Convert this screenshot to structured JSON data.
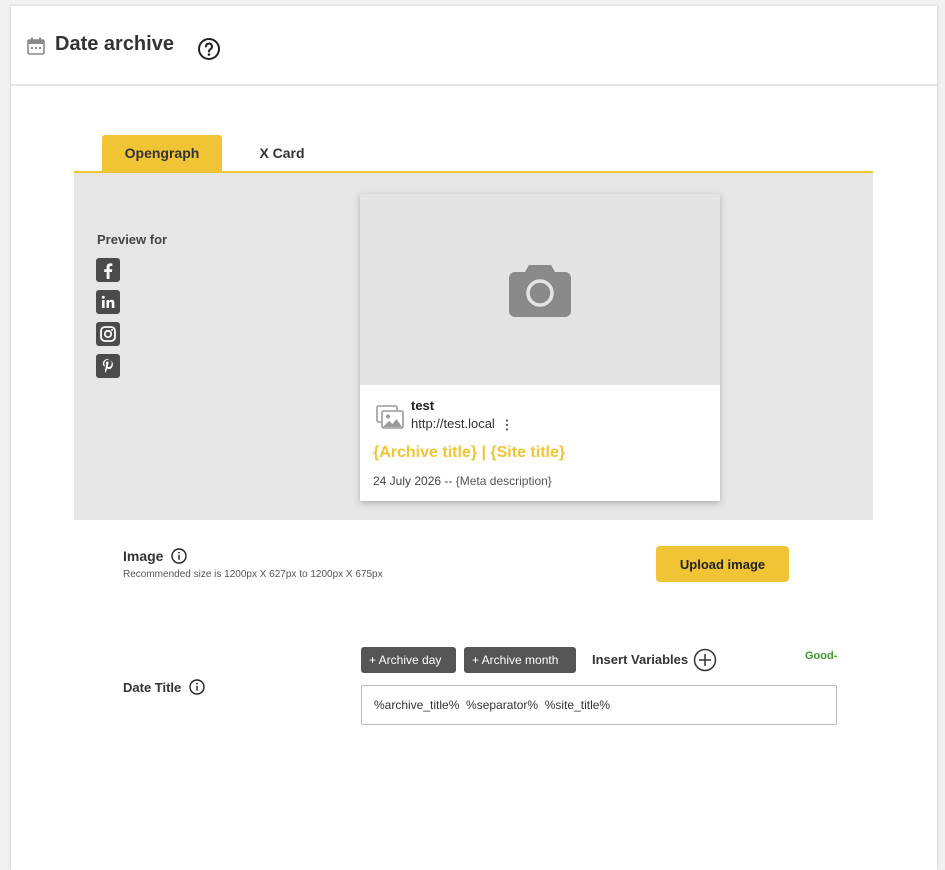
{
  "header": {
    "title": "Date archive",
    "icon": "calendar-icon",
    "help_icon": "help-icon"
  },
  "tabs": [
    {
      "label": "Opengraph",
      "active": true
    },
    {
      "label": "X Card",
      "active": false
    }
  ],
  "preview": {
    "preview_for_label": "Preview for",
    "platforms": [
      "facebook-icon",
      "linkedin-icon",
      "instagram-icon",
      "pinterest-icon"
    ],
    "card": {
      "site_name": "test",
      "site_url": "http://test.local",
      "title": "{Archive title} | {Site title}",
      "date": "24 July 2026",
      "separator": "--",
      "description": "{Meta description}"
    }
  },
  "image_section": {
    "label": "Image",
    "hint": "Recommended size is 1200px X 627px to 1200px X 675px",
    "upload_label": "Upload image"
  },
  "date_title": {
    "label": "Date Title",
    "variables": [
      "+ Archive day",
      "+ Archive month"
    ],
    "insert_label": "Insert Variables",
    "status": "Good-",
    "value": "%archive_title%  %separator%  %site_title%"
  },
  "colors": {
    "accent": "#f0c435",
    "preview_bg": "#e6e6e6",
    "status_good": "#3c9a2a",
    "variable_btn": "#555555"
  }
}
